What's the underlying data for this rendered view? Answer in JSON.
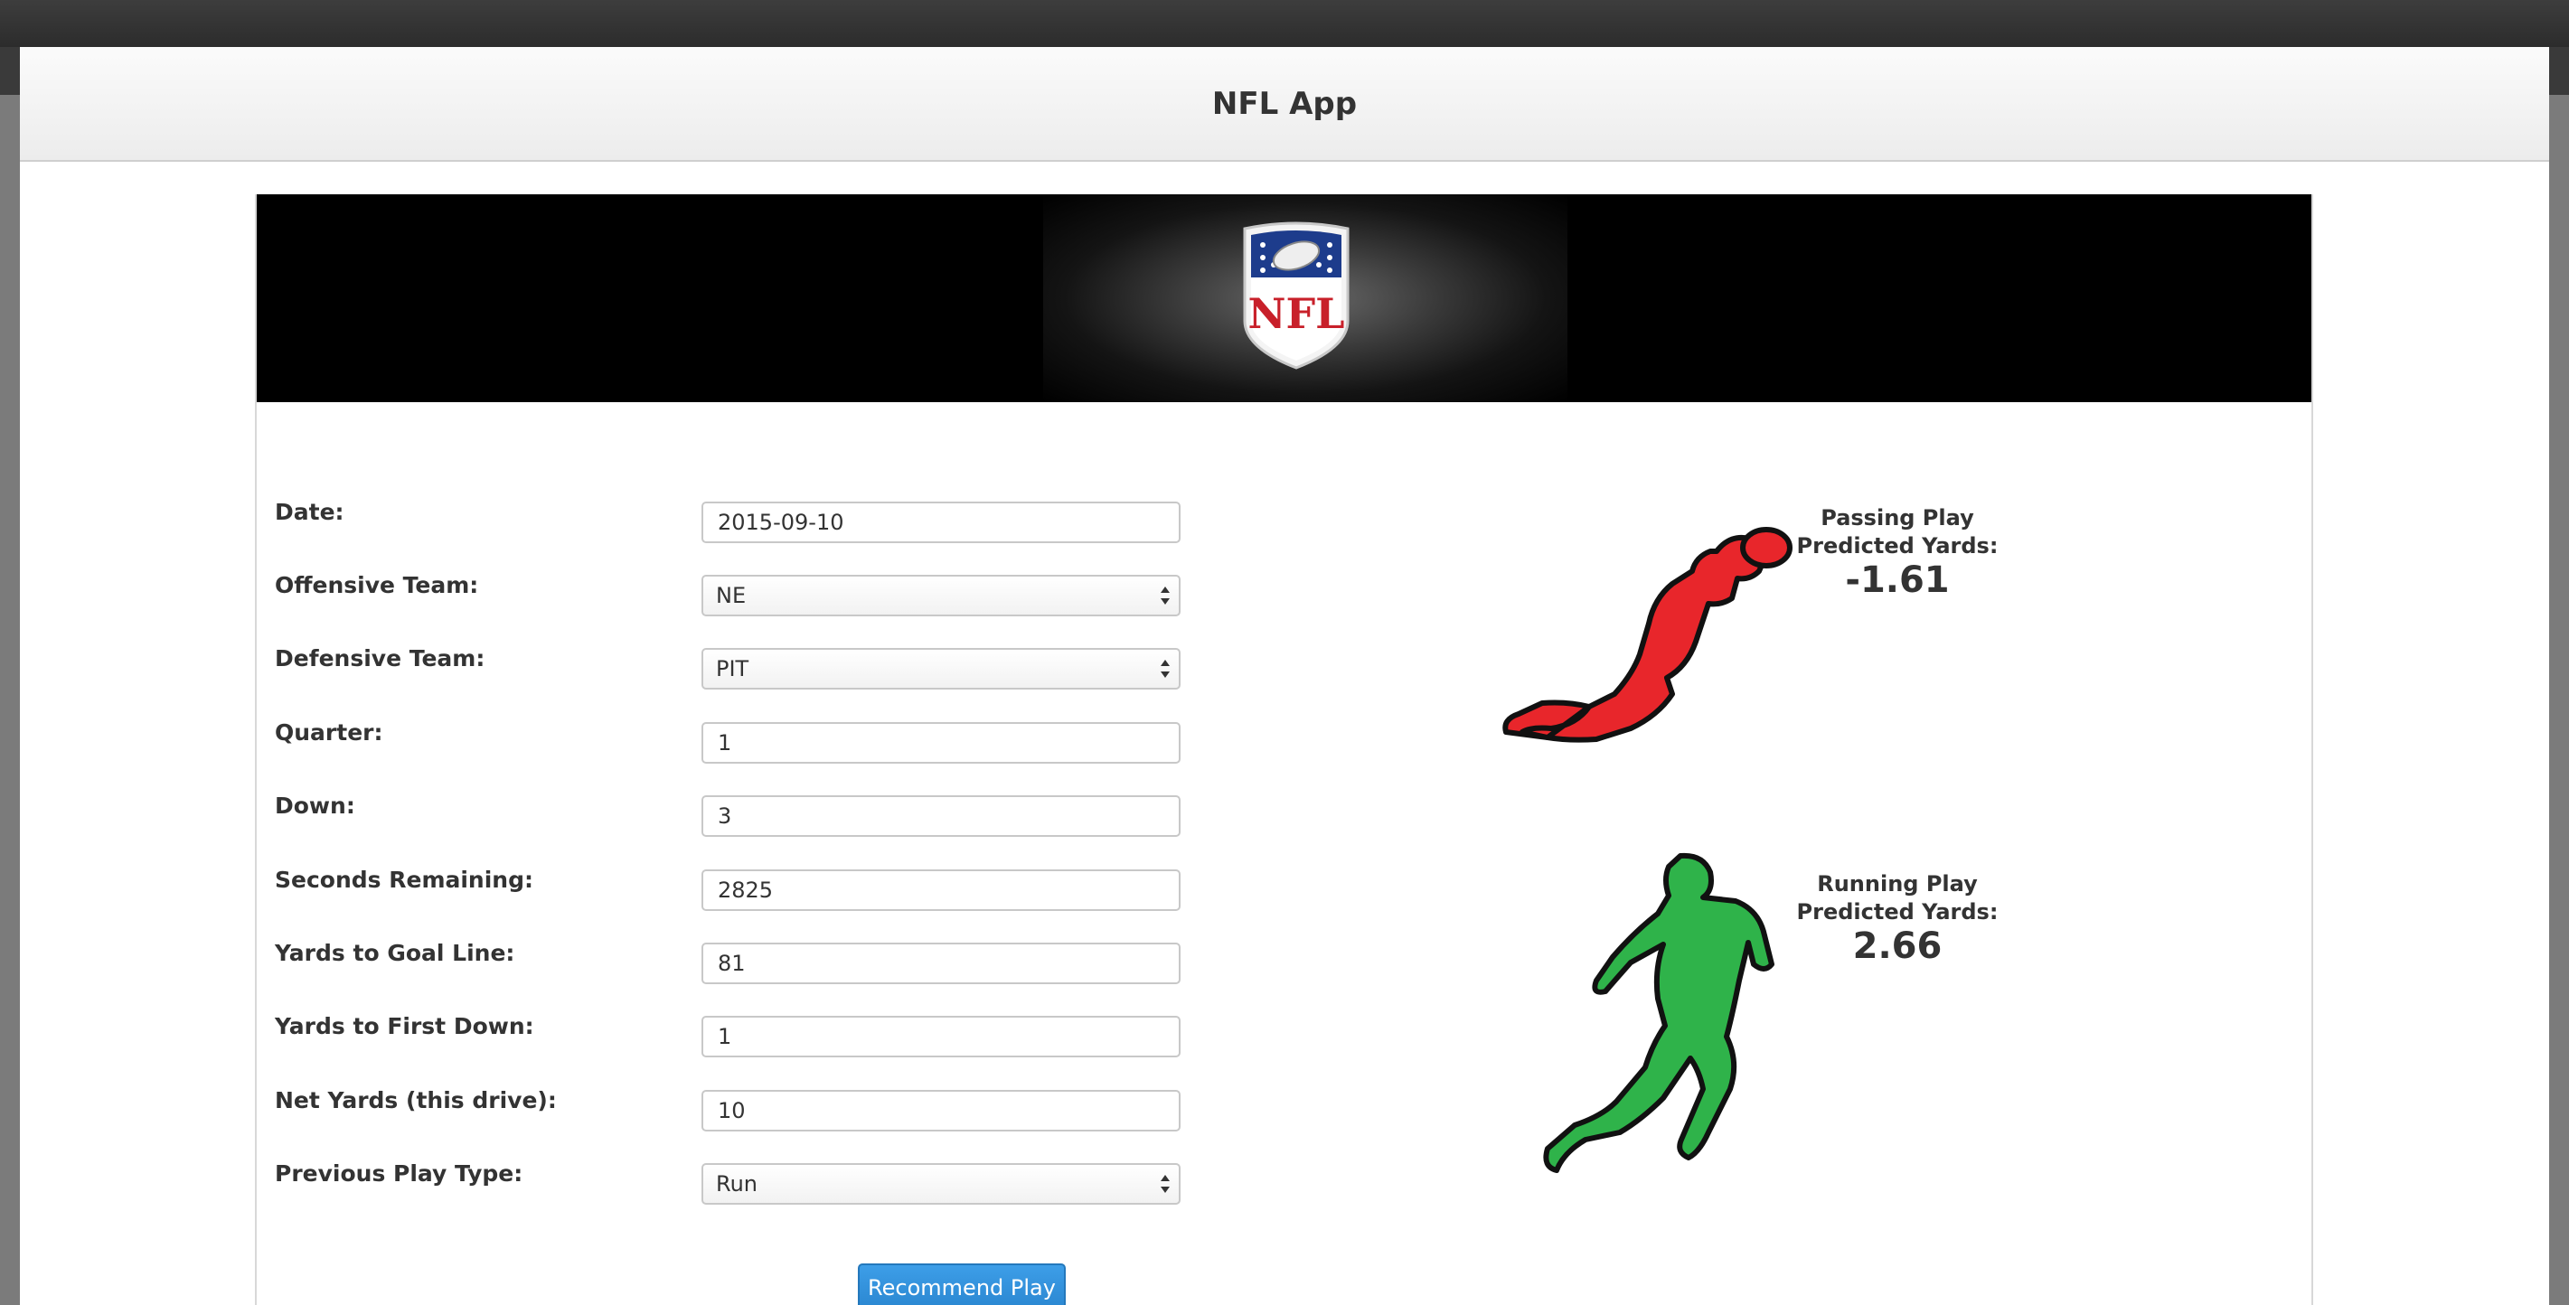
{
  "app": {
    "title": "NFL App"
  },
  "form": {
    "date": {
      "label": "Date:",
      "value": "2015-09-10"
    },
    "offensive_team": {
      "label": "Offensive Team:",
      "value": "NE"
    },
    "defensive_team": {
      "label": "Defensive Team:",
      "value": "PIT"
    },
    "quarter": {
      "label": "Quarter:",
      "value": "1"
    },
    "down": {
      "label": "Down:",
      "value": "3"
    },
    "seconds_remaining": {
      "label": "Seconds Remaining:",
      "value": "2825"
    },
    "yards_to_goal": {
      "label": "Yards to Goal Line:",
      "value": "81"
    },
    "yards_to_first": {
      "label": "Yards to First Down:",
      "value": "1"
    },
    "net_yards": {
      "label": "Net Yards (this drive):",
      "value": "10"
    },
    "previous_play": {
      "label": "Previous Play Type:",
      "value": "Run"
    },
    "submit_label": "Recommend Play"
  },
  "predictions": {
    "passing": {
      "title_line1": "Passing Play",
      "title_line2": "Predicted Yards:",
      "value": "-1.61",
      "color": "#e8262b"
    },
    "running": {
      "title_line1": "Running Play",
      "title_line2": "Predicted Yards:",
      "value": "2.66",
      "color": "#2fb34a"
    }
  },
  "banner": {
    "logo_text": "NFL"
  }
}
